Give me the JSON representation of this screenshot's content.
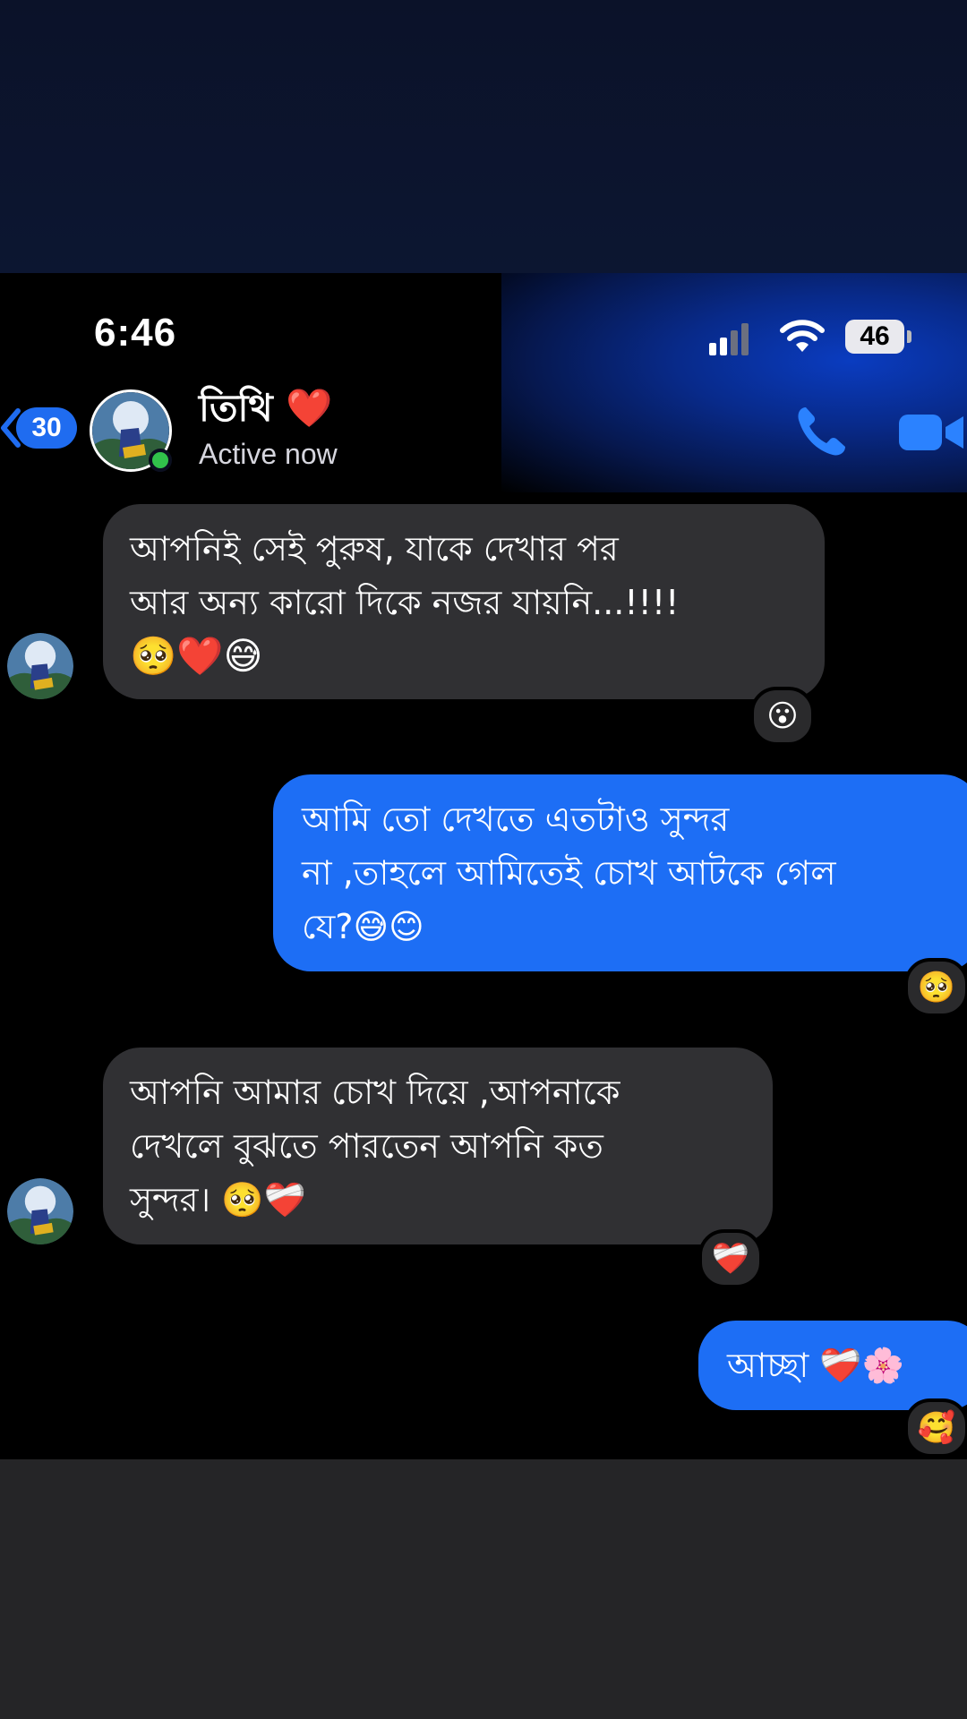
{
  "status_bar": {
    "time": "6:46",
    "battery": "46"
  },
  "header": {
    "back_count": "30",
    "contact_name": "তিথি ❤️",
    "status": "Active now"
  },
  "messages": [
    {
      "side": "incoming",
      "lines": [
        "আপনিই সেই পুরুষ, যাকে দেখার পর",
        "আর অন্য কারো দিকে নজর যায়নি...!!!!"
      ],
      "emoji_line": "🥺❤️😅",
      "reaction": "😮"
    },
    {
      "side": "outgoing",
      "lines": [
        "আমি তো দেখতে এতটাও সুন্দর",
        "না ,তাহলে আমিতেই চোখ আটকে গেল",
        "যে?😅😊"
      ],
      "reaction": "🥺"
    },
    {
      "side": "incoming",
      "lines": [
        "আপনি আমার চোখ দিয়ে ,আপনাকে",
        "দেখলে  বুঝতে পারতেন আপনি কত",
        "সুন্দর। 🥺❤️‍🩹"
      ],
      "reaction": "❤️‍🩹"
    },
    {
      "side": "outgoing",
      "lines": [
        "আচ্ছা ❤️‍🩹🌸"
      ],
      "reaction": "🥰"
    }
  ],
  "colors": {
    "outgoing_bubble": "#1d6ef5",
    "incoming_bubble": "#303033",
    "online": "#31c24b",
    "accent": "#1f6cf0"
  },
  "icons": [
    "back-chevron-icon",
    "phone-call-icon",
    "video-call-icon",
    "signal-icon",
    "wifi-icon",
    "battery-icon"
  ]
}
